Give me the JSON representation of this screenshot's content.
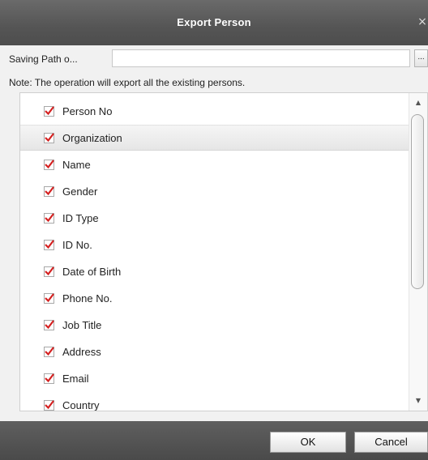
{
  "dialog": {
    "title": "Export Person",
    "close_glyph": "×"
  },
  "path": {
    "label": "Saving Path o...",
    "value": "",
    "browse_label": "..."
  },
  "note": "Note: The operation will export all the existing persons.",
  "fields": [
    {
      "label": "Person No",
      "checked": true
    },
    {
      "label": "Organization",
      "checked": true
    },
    {
      "label": "Name",
      "checked": true
    },
    {
      "label": "Gender",
      "checked": true
    },
    {
      "label": "ID Type",
      "checked": true
    },
    {
      "label": "ID No.",
      "checked": true
    },
    {
      "label": "Date of Birth",
      "checked": true
    },
    {
      "label": "Phone No.",
      "checked": true
    },
    {
      "label": "Job Title",
      "checked": true
    },
    {
      "label": "Address",
      "checked": true
    },
    {
      "label": "Email",
      "checked": true
    },
    {
      "label": "Country",
      "checked": true
    }
  ],
  "selected_index": 1,
  "buttons": {
    "ok": "OK",
    "cancel": "Cancel"
  },
  "colors": {
    "checkmark": "#d42020",
    "titlebar": "#555555"
  },
  "icons": {
    "check": "check-icon",
    "close": "close-icon",
    "scroll_up": "scroll-up-icon",
    "scroll_down": "scroll-down-icon"
  }
}
